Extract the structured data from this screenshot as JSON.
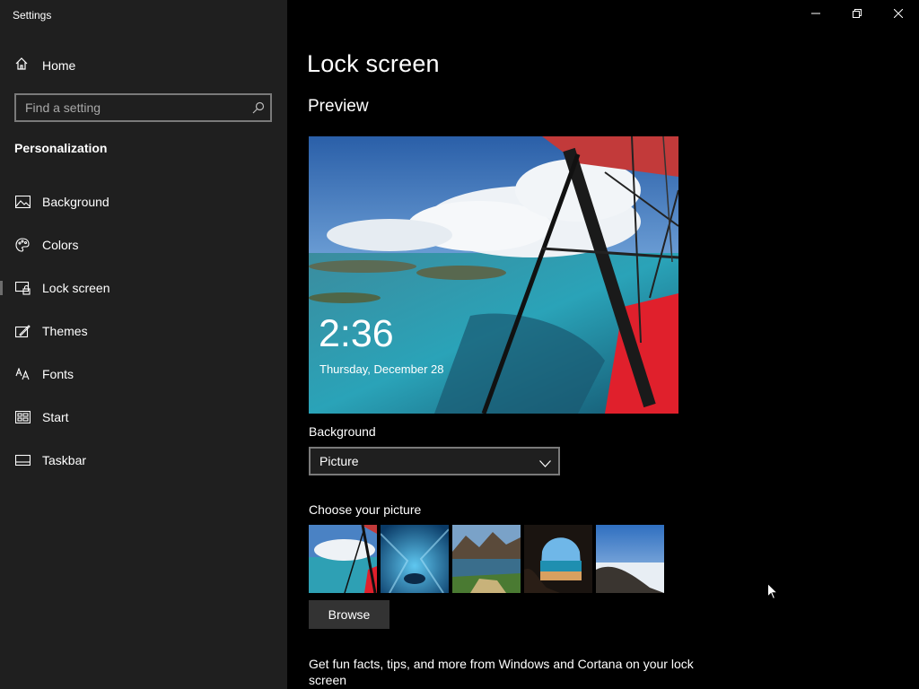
{
  "window": {
    "title": "Settings",
    "controls": {
      "minimize": "minimize-icon",
      "restore": "restore-icon",
      "close": "close-icon"
    }
  },
  "sidebar": {
    "home_label": "Home",
    "search": {
      "placeholder": "Find a setting",
      "value": ""
    },
    "section_title": "Personalization",
    "items": [
      {
        "label": "Background",
        "icon": "picture-icon"
      },
      {
        "label": "Colors",
        "icon": "palette-icon"
      },
      {
        "label": "Lock screen",
        "icon": "lock-screen-icon",
        "selected": true
      },
      {
        "label": "Themes",
        "icon": "themes-icon"
      },
      {
        "label": "Fonts",
        "icon": "fonts-icon"
      },
      {
        "label": "Start",
        "icon": "start-icon"
      },
      {
        "label": "Taskbar",
        "icon": "taskbar-icon"
      }
    ]
  },
  "main": {
    "page_title": "Lock screen",
    "preview_heading": "Preview",
    "preview": {
      "time": "2:36",
      "date": "Thursday, December 28"
    },
    "background_label": "Background",
    "background_value": "Picture",
    "choose_picture_label": "Choose your picture",
    "browse_label": "Browse",
    "fun_facts_text": "Get fun facts, tips, and more from Windows and Cortana on your lock screen"
  },
  "colors": {
    "sidebar_bg": "#1f1f1f",
    "main_bg": "#000000",
    "control_border": "#7a7a7a",
    "button_bg": "#333333"
  }
}
